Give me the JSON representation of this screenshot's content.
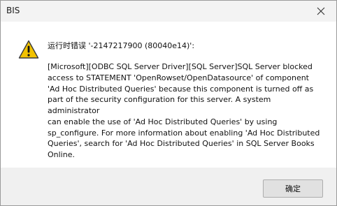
{
  "window": {
    "title": "BIS"
  },
  "dialog": {
    "header": "运行时错误 '-2147217900 (80040e14)':",
    "message": "[Microsoft][ODBC SQL Server Driver][SQL Server]SQL Server blocked\naccess to STATEMENT 'OpenRowset/OpenDatasource' of component\n'Ad Hoc Distributed Queries' because this component is turned off as\npart of the security configuration for this server. A system administrator\ncan enable the use of 'Ad Hoc Distributed Queries' by using\nsp_configure. For more information about enabling 'Ad Hoc Distributed\nQueries', search for 'Ad Hoc Distributed Queries' in SQL Server Books\nOnline.",
    "ok_label": "确定",
    "icon": "warning-icon"
  },
  "colors": {
    "warning_fill": "#f2c200",
    "warning_border": "#3a3a3a"
  }
}
